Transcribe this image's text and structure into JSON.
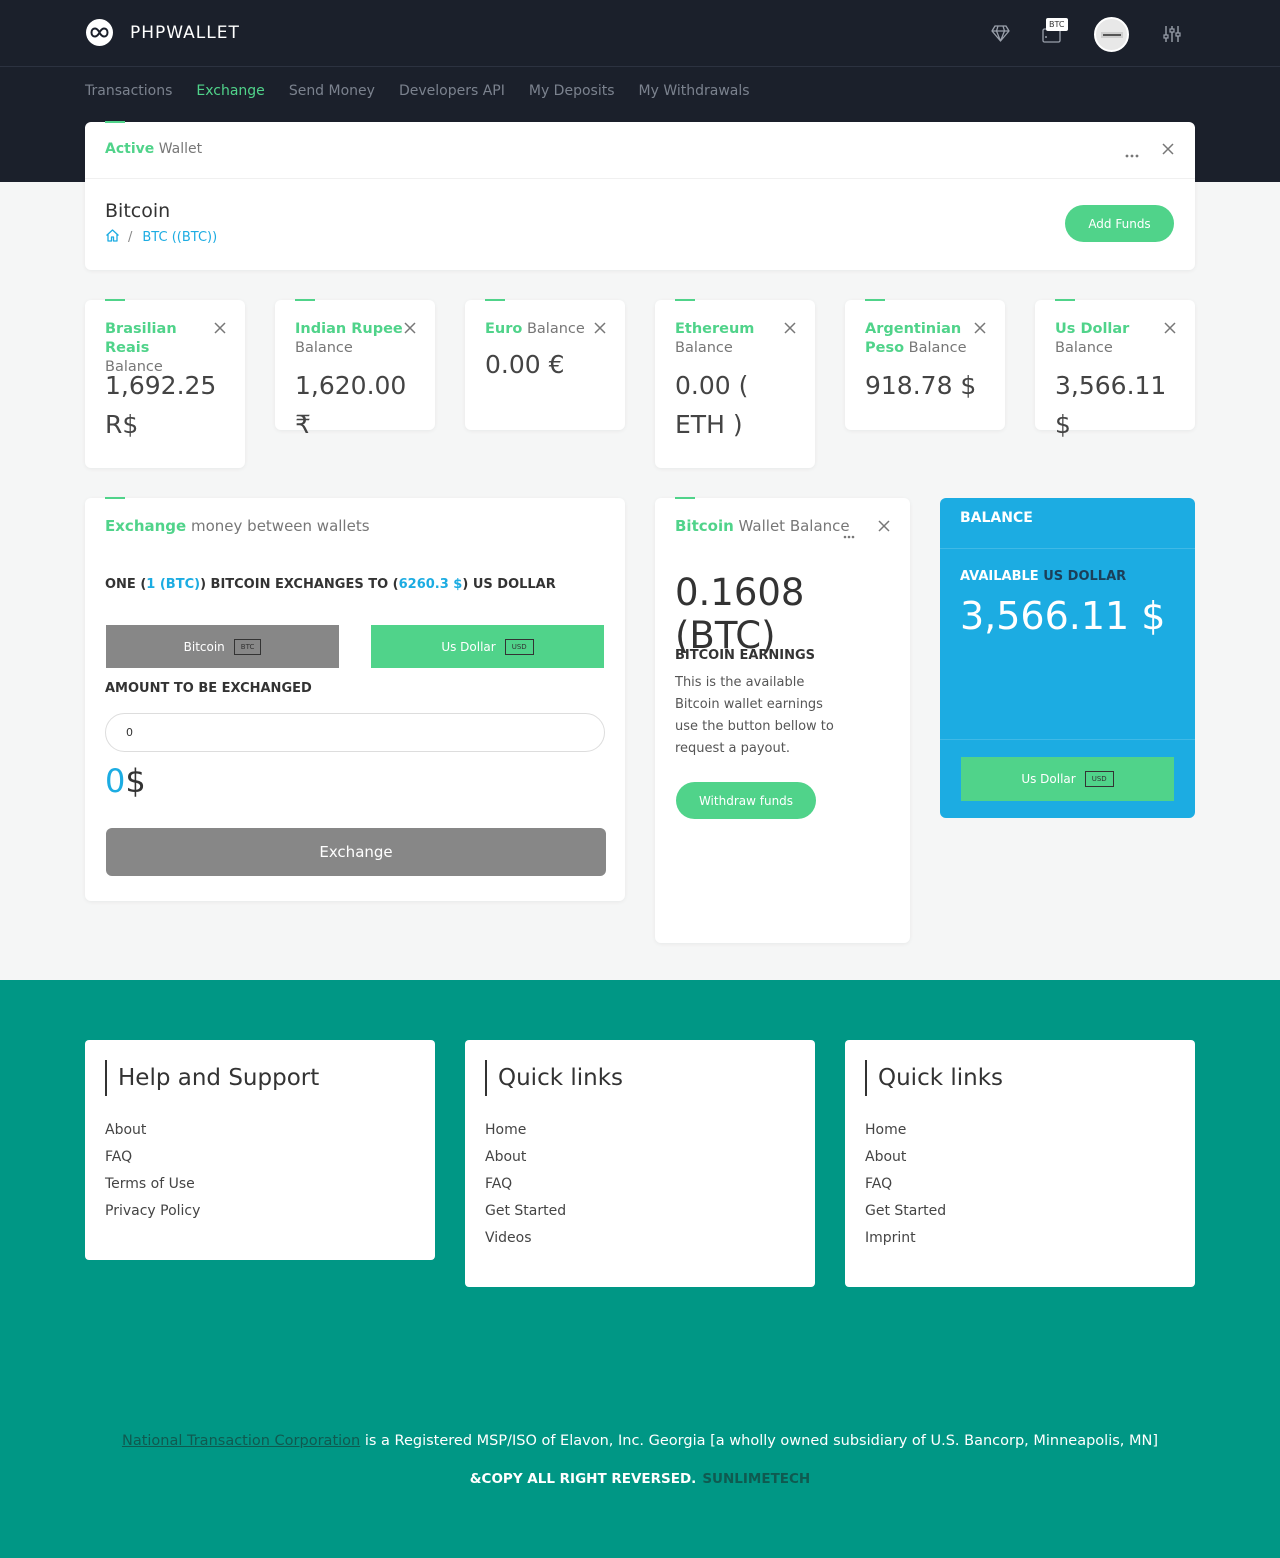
{
  "brand": {
    "name": "PHPWALLET"
  },
  "header": {
    "wallet_badge": "BTC",
    "icons": [
      "diamond-icon",
      "wallet-icon",
      "avatar",
      "sliders-icon"
    ]
  },
  "nav": {
    "items": [
      "Transactions",
      "Exchange",
      "Send Money",
      "Developers API",
      "My Deposits",
      "My Withdrawals"
    ],
    "active": "Exchange"
  },
  "active_wallet": {
    "title_strong": "Active",
    "title_rest": "Wallet",
    "wallet_name": "Bitcoin",
    "crumb_sep": "/",
    "crumb_link": "BTC ((BTC))",
    "add_funds": "Add Funds"
  },
  "balances": [
    {
      "strong": "Brasilian Reais",
      "rest": "Balance",
      "value": "1,692.25 R$"
    },
    {
      "strong": "Indian Rupee",
      "rest": "Balance",
      "value": "1,620.00 ₹"
    },
    {
      "strong": "Euro",
      "rest": "Balance",
      "value": "0.00 €"
    },
    {
      "strong": "Ethereum",
      "rest": "Balance",
      "value": "0.00 ( ETH )"
    },
    {
      "strong": "Argentinian Peso",
      "rest": "Balance",
      "value": "918.78 $"
    },
    {
      "strong": "Us Dollar",
      "rest": "Balance",
      "value": "3,566.11 $"
    }
  ],
  "exchange": {
    "title_strong": "Exchange",
    "title_rest": "money between wallets",
    "rate": {
      "pre": "ONE (",
      "from_amount": "1 (BTC)",
      "mid": ") BITCOIN EXCHANGES TO (",
      "to_amount": "6260.3 $",
      "post": ") US DOLLAR"
    },
    "from": {
      "label": "Bitcoin",
      "tag": "BTC"
    },
    "to": {
      "label": "Us Dollar",
      "tag": "USD"
    },
    "amount_label": "AMOUNT TO BE EXCHANGED",
    "amount_value": "0",
    "result_value": "0",
    "result_currency": "$",
    "button": "Exchange"
  },
  "wallet_balance": {
    "title_strong": "Bitcoin",
    "title_rest": "Wallet Balance",
    "value": "0.1608 (BTC)",
    "earnings_label": "BITCOIN EARNINGS",
    "earnings_text": "This is the available Bitcoin wallet earnings use the button bellow to request a payout.",
    "withdraw": "Withdraw funds"
  },
  "balance_card": {
    "title": "BALANCE",
    "available_label": "AVAILABLE",
    "available_currency": "US DOLLAR",
    "value": "3,566.11 $",
    "button": {
      "label": "Us Dollar",
      "tag": "USD"
    }
  },
  "footer": {
    "columns": [
      {
        "title": "Help and Support",
        "links": [
          "About",
          "FAQ",
          "Terms of Use",
          "Privacy Policy"
        ]
      },
      {
        "title": "Quick links",
        "links": [
          "Home",
          "About",
          "FAQ",
          "Get Started",
          "Videos"
        ]
      },
      {
        "title": "Quick links",
        "links": [
          "Home",
          "About",
          "FAQ",
          "Get Started",
          "Imprint"
        ]
      }
    ],
    "legal_link": "National Transaction Corporation",
    "legal_text": " is a Registered MSP/ISO of Elavon, Inc. Georgia [a wholly owned subsidiary of U.S. Bancorp, Minneapolis, MN]",
    "copy": "&COPY ALL RIGHT REVERSED.",
    "copy_brand": "SUNLIMETECH"
  },
  "colors": {
    "accent": "#50d38a",
    "link": "#1cace2",
    "header_bg": "#1b202b",
    "footer_bg": "#009785",
    "gray_button": "#878787"
  }
}
